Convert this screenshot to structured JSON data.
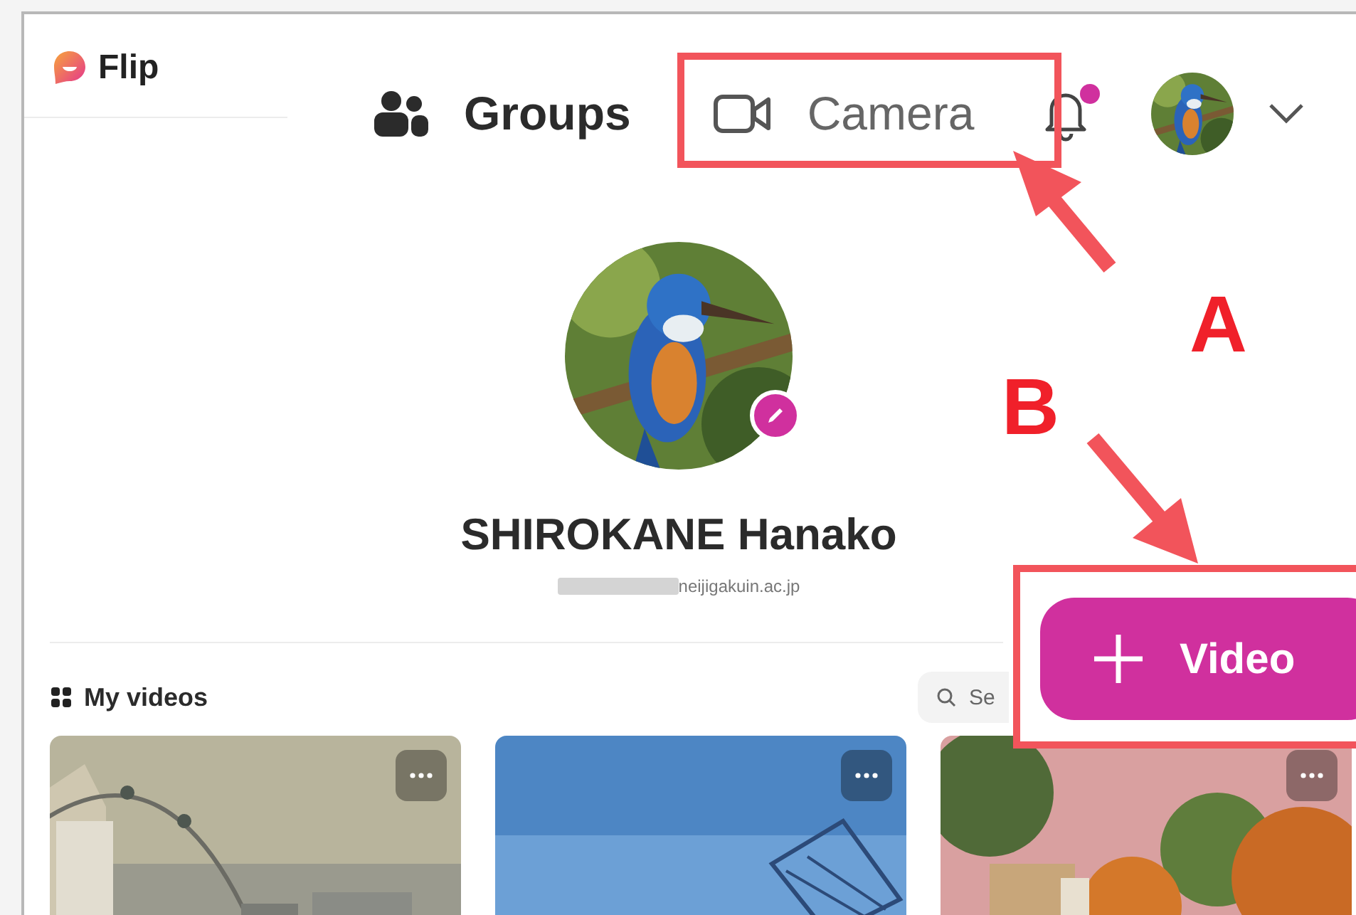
{
  "app": {
    "name": "Flip"
  },
  "nav": [
    {
      "kind": "groups",
      "label": "Groups",
      "selected": false
    },
    {
      "kind": "camera",
      "label": "Camera",
      "selected": false
    }
  ],
  "notifications": {
    "unread": true
  },
  "profile": {
    "name": "SHIROKANE Hanako",
    "email": "neijigakuin.ac.jp"
  },
  "section": {
    "title": "My videos"
  },
  "search": {
    "placeholder": "Se"
  },
  "add_button": {
    "label": "Video"
  },
  "annotations": [
    {
      "label": "A"
    },
    {
      "label": "B"
    }
  ]
}
